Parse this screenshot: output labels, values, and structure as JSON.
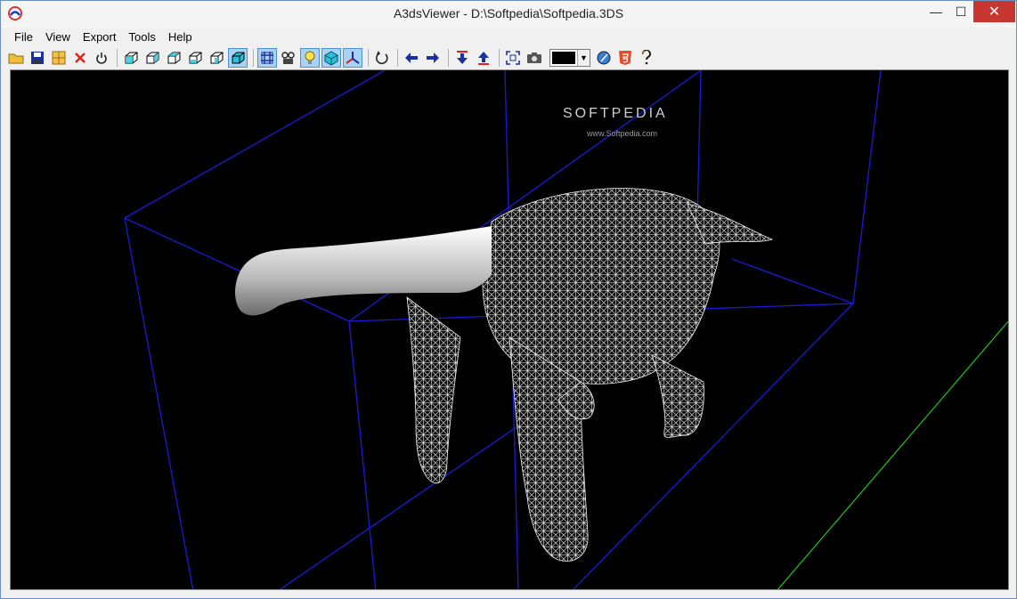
{
  "window": {
    "title": "A3dsViewer - D:\\Softpedia\\Softpedia.3DS"
  },
  "controls": {
    "minimize": "—",
    "maximize": "☐",
    "close": "✕"
  },
  "menu": [
    {
      "label": "File"
    },
    {
      "label": "View"
    },
    {
      "label": "Export"
    },
    {
      "label": "Tools"
    },
    {
      "label": "Help"
    }
  ],
  "watermark": {
    "text": "SOFTPEDIA",
    "sub": "www.Softpedia.com"
  },
  "toolbar": {
    "color_value": "#000000",
    "buttons": [
      "open-folder-icon",
      "save-icon",
      "grid-icon",
      "close-file-icon",
      "power-icon",
      "view-front-icon",
      "view-back-icon",
      "view-left-icon",
      "view-right-icon",
      "view-top-icon",
      "view-perspective-icon",
      "wireframe-icon",
      "animation-icon",
      "light-icon",
      "solid-icon",
      "axes-icon",
      "rotate-icon",
      "arrow-left-icon",
      "arrow-right-icon",
      "move-down-icon",
      "move-up-icon",
      "fullscreen-icon",
      "screenshot-icon",
      "web-icon",
      "html5-icon",
      "help-icon"
    ]
  },
  "colors": {
    "viewport_bg": "#000000",
    "bounding_box": "#1a1ad8",
    "axis_line": "#22c422",
    "mesh": "#e8e8e8"
  }
}
